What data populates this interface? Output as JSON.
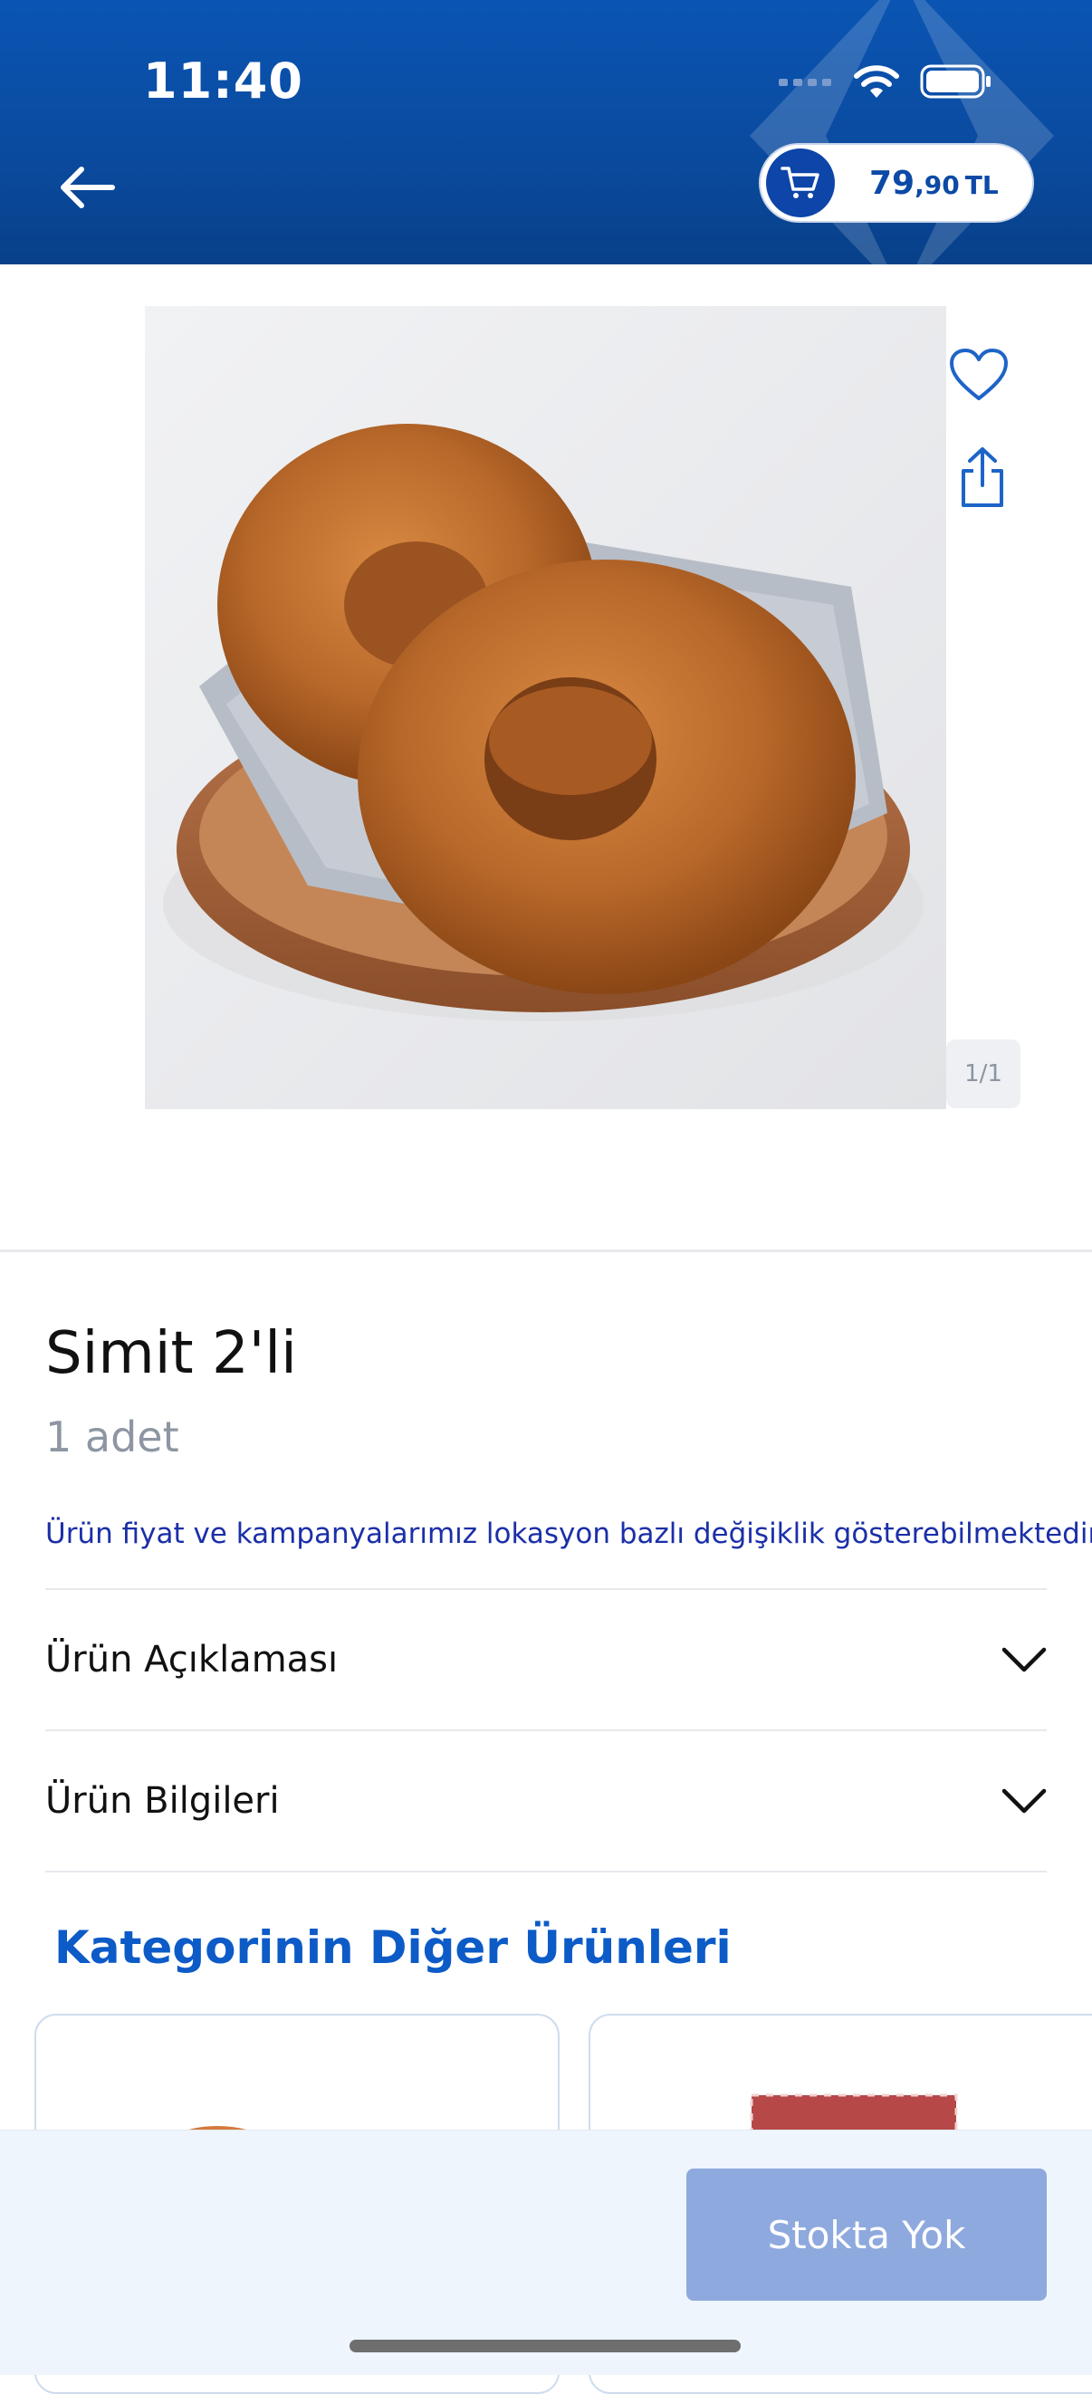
{
  "status_bar": {
    "time": "11:40"
  },
  "header": {
    "cart_price_int": "79",
    "cart_price_dec": ",90",
    "cart_currency": "TL"
  },
  "gallery": {
    "counter": "1/1"
  },
  "product": {
    "title": "Simit 2'li",
    "unit": "1 adet",
    "notice": "Ürün fiyat ve kampanyalarımız lokasyon bazlı değişiklik gösterebilmektedir."
  },
  "accordions": [
    {
      "label": "Ürün Açıklaması"
    },
    {
      "label": "Ürün Bilgileri"
    }
  ],
  "related": {
    "title": "Kategorinin Diğer Ürünleri"
  },
  "footer": {
    "stock_button": "Stokta Yok"
  },
  "colors": {
    "header_blue": "#0a4a9e",
    "accent_blue": "#0c5bc7",
    "disabled_button": "#8ea9de"
  }
}
